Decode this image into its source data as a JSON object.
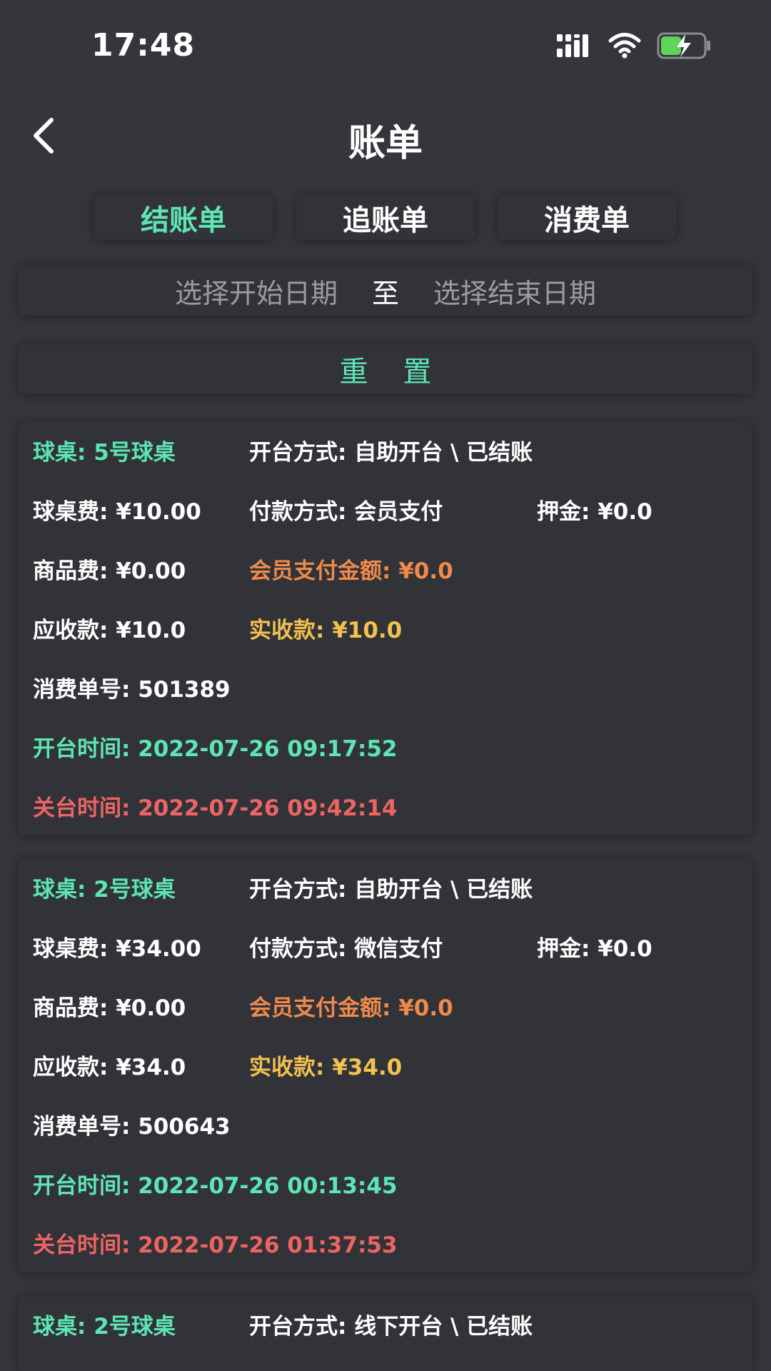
{
  "status": {
    "time": "17:48"
  },
  "nav": {
    "title": "账单"
  },
  "tabs": [
    {
      "label": "结账单",
      "active": true
    },
    {
      "label": "追账单",
      "active": false
    },
    {
      "label": "消费单",
      "active": false
    }
  ],
  "filter": {
    "start_placeholder": "选择开始日期",
    "separator": "至",
    "end_placeholder": "选择结束日期",
    "reset_label": "重 置"
  },
  "colors": {
    "accent_green": "#5de6b3",
    "orange": "#ee8a4a",
    "yellow": "#f2c14e",
    "red": "#ee6464",
    "background": "#34363b"
  },
  "bills": [
    {
      "table": "球桌: 5号球桌",
      "open_mode": "开台方式: 自助开台 \\ 已结账",
      "table_fee": "球桌费: ¥10.00",
      "pay_method": "付款方式: 会员支付",
      "deposit": "押金: ¥0.0",
      "goods_fee": "商品费: ¥0.00",
      "member_paid": "会员支付金额: ¥0.0",
      "receivable": "应收款: ¥10.0",
      "received": "实收款: ¥10.0",
      "order_no": "消费单号: 501389",
      "open_time": "开台时间: 2022-07-26 09:17:52",
      "close_time": "关台时间: 2022-07-26 09:42:14"
    },
    {
      "table": "球桌: 2号球桌",
      "open_mode": "开台方式: 自助开台 \\ 已结账",
      "table_fee": "球桌费: ¥34.00",
      "pay_method": "付款方式: 微信支付",
      "deposit": "押金: ¥0.0",
      "goods_fee": "商品费: ¥0.00",
      "member_paid": "会员支付金额: ¥0.0",
      "receivable": "应收款: ¥34.0",
      "received": "实收款: ¥34.0",
      "order_no": "消费单号: 500643",
      "open_time": "开台时间: 2022-07-26 00:13:45",
      "close_time": "关台时间: 2022-07-26 01:37:53"
    },
    {
      "table": "球桌: 2号球桌",
      "open_mode": "开台方式: 线下开台 \\ 已结账"
    }
  ]
}
